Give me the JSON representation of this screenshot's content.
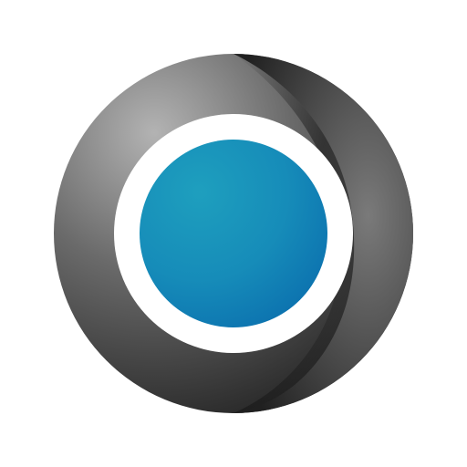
{
  "image": {
    "background_color": "#ffffff",
    "logo": {
      "icon": "ring-lens-logo-icon",
      "outer_ring_colors": {
        "light": "#b3b3b3",
        "mid": "#5b5b5b",
        "dark": "#262626"
      },
      "inner_gap_color": "#ffffff",
      "core_colors": {
        "light": "#1e9fbe",
        "dark": "#0b6fae"
      }
    }
  }
}
